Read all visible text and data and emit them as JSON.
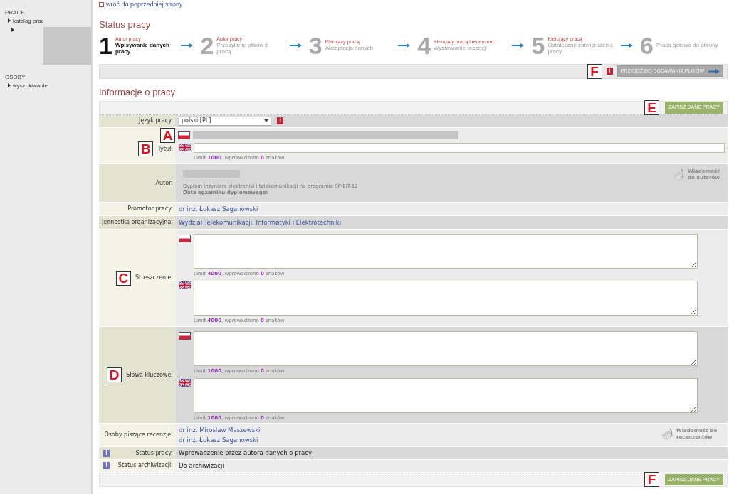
{
  "sidebar": {
    "sections": [
      {
        "title": "PRACE",
        "items": [
          {
            "label": "katalog prac",
            "children": [
              {
                "redacted": true
              }
            ]
          }
        ]
      },
      {
        "title": "OSOBY",
        "items": [
          {
            "label": "wyszukiwanie"
          }
        ]
      }
    ]
  },
  "back_link": "wróć do poprzedniej strony",
  "status_heading": "Status pracy",
  "steps": [
    {
      "number": "1",
      "role": "Autor pracy",
      "title": "Wpisywanie danych pracy",
      "selected": true
    },
    {
      "number": "2",
      "role": "Autor pracy",
      "title": "Przesyłanie plików z pracą",
      "selected": false
    },
    {
      "number": "3",
      "role": "Kierujący pracą",
      "title": "Akceptacja danych",
      "selected": false
    },
    {
      "number": "4",
      "role": "Kierujący pracą i recenzenci",
      "title": "Wystawianie recenzji",
      "selected": false
    },
    {
      "number": "5",
      "role": "Kierujący pracą",
      "title": "Ostateczne zatwierdzenie pracy",
      "selected": false
    },
    {
      "number": "6",
      "title": "Praca gotowa do obrony",
      "selected": false
    }
  ],
  "next_bar": {
    "annotation": "F",
    "info": "i",
    "button": "PRZEJDŹ DO DODAWANIA PLIKÓW"
  },
  "info_heading": "Informacje o pracy",
  "save_top": {
    "annotation": "E",
    "button": "ZAPISZ DANE PRACY"
  },
  "rows": [
    {
      "kind": "select",
      "label": "Język pracy:",
      "value": "polski [PL]",
      "info": "i"
    },
    {
      "kind": "title",
      "label": "Tytuł:",
      "annotation_flag": "A",
      "annotation_label": "B",
      "limit": "Limit **1000**, wprowadzono **0** znaków"
    },
    {
      "kind": "author",
      "label": "Autor:",
      "line1": "Dyplom inżyniera elektroniki i telekomunikacji na programie SP-EIT-12",
      "line2": "Data egzaminu dyplomowego:",
      "message": "Wiadomość do autorów"
    },
    {
      "kind": "links",
      "label": "Promotor pracy:",
      "links": [
        "dr inż. Łukasz Saganowski"
      ]
    },
    {
      "kind": "links",
      "label": "Jednostka organizacyjna:",
      "links": [
        "Wydział Telekomunikacji, Informatyki i Elektrotechniki"
      ]
    },
    {
      "kind": "textareas",
      "label": "Streszczenie:",
      "annotation": "C",
      "limits": [
        "Limit **4000**, wprowadzono **0** znaków",
        "Limit **4000**, wprowadzono **0** znaków"
      ]
    },
    {
      "kind": "textareas",
      "label": "Słowa kluczowe:",
      "annotation": "D",
      "limits": [
        "Limit **1000**, wprowadzono **0** znaków",
        "Limit **1000**, wprowadzono **0** znaków"
      ]
    },
    {
      "kind": "links",
      "label": "Osoby piszące recenzje:",
      "links": [
        "dr inż. Mirosław Maszewski",
        "dr inż. Łukasz Saganowski"
      ],
      "message": "Wiadomość do recenzentów"
    },
    {
      "kind": "status",
      "icon": "i",
      "label": "Status pracy:",
      "value": "Wprowadzenie przez autora danych o pracy"
    },
    {
      "kind": "status",
      "icon": "i",
      "label": "Status archiwizacji:",
      "value": "Do archiwizacji"
    }
  ],
  "save_bottom": {
    "annotation": "F",
    "button": "ZAPISZ DANE PRACY"
  }
}
